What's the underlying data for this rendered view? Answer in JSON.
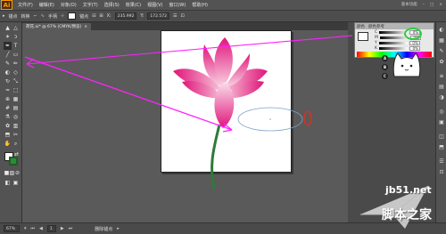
{
  "app": {
    "logo": "Ai"
  },
  "menubar": {
    "items": [
      "文件(F)",
      "编辑(E)",
      "对象(O)",
      "文字(T)",
      "选择(S)",
      "效果(C)",
      "视图(V)",
      "窗口(W)",
      "帮助(H)"
    ],
    "workspace": "基本功能",
    "search_placeholder": ""
  },
  "control_bar": {
    "selection_label": "锚点",
    "convert_label": "转换",
    "handles_label": "手柄",
    "anchor_label": "锚点",
    "x_value": "235.992",
    "y_value": "172.572",
    "stroke_swatch_color": "#ffffff"
  },
  "document_tab": {
    "title": "荷花.ai* @ 67% (CMYK/预览)"
  },
  "color_panel": {
    "tab1": "颜色",
    "tab2": "颜色参考",
    "rows": [
      {
        "label": "C",
        "value": "0%"
      },
      {
        "label": "M",
        "value": "0%"
      },
      {
        "label": "Y",
        "value": "0%"
      },
      {
        "label": "K",
        "value": "0%"
      }
    ],
    "highlight_color": "#2ecc40"
  },
  "status_bar": {
    "zoom": "67%",
    "page": "1",
    "tool_status": "删除锚点"
  },
  "watermark": {
    "site": "jb51.net",
    "name": "脚本之家"
  },
  "colors": {
    "petal_dark": "#e0157a",
    "petal_light": "#f7c6dc",
    "stem": "#2f7a3a",
    "arrow": "#ff22ff",
    "ellipse": "#7ea3c8",
    "highlight_ring": "#e03020"
  }
}
